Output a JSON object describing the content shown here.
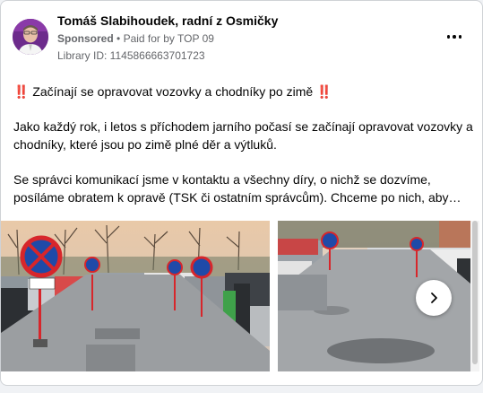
{
  "post": {
    "author": "Tomáš Slabihoudek, radní z Osmičky",
    "sponsored": "Sponsored",
    "separator": "•",
    "paid_for": "Paid for by TOP 09",
    "library_id": "Library ID: 1145866663701723",
    "paragraphs": [
      "‼️ Začínají se opravovat vozovky a chodníky po zimě ‼️",
      "Jako každý rok, i letos s příchodem jarního počasí se začínají opravovat vozovky a chodníky, které jsou po zimě plné děr a výtluků.",
      "Se správci komunikací jsme v kontaktu a všechny díry, o nichž se dozvíme, posíláme obratem k opravě (TSK či ostatním správcům). Chceme po nich, aby…"
    ]
  },
  "icons": {
    "more": "more-options-icon",
    "next": "chevron-right-icon"
  },
  "colors": {
    "author_avatar": "#6d2b8c",
    "meta_text": "#65676b",
    "sign_red": "#d7262b",
    "sign_blue": "#1f4aa8"
  }
}
